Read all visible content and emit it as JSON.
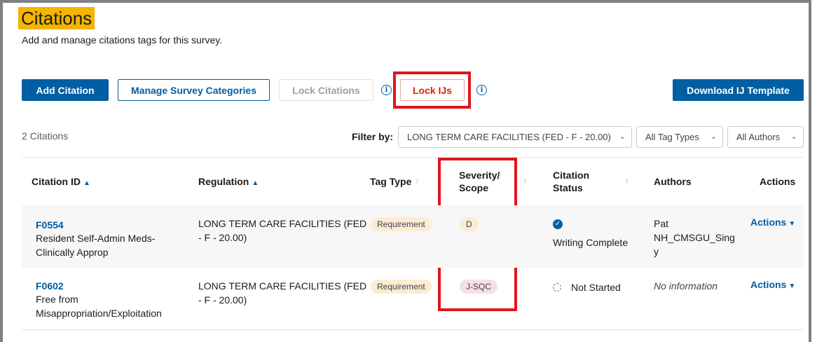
{
  "page": {
    "title": "Citations",
    "subtitle": "Add and manage citations tags for this survey."
  },
  "toolbar": {
    "add_citation": "Add Citation",
    "manage_categories": "Manage Survey Categories",
    "lock_citations": "Lock Citations",
    "lock_ijs": "Lock IJs",
    "download_ij_template": "Download IJ Template",
    "info_icon_glyph": "i"
  },
  "filters": {
    "count_label": "2 Citations",
    "filter_label": "Filter by:",
    "regulation_value": "LONG TERM CARE FACILITIES (FED - F - 20.00)",
    "tag_type_value": "All Tag Types",
    "authors_value": "All Authors"
  },
  "table": {
    "headers": {
      "citation_id": "Citation ID",
      "regulation": "Regulation",
      "tag_type": "Tag Type",
      "severity_line1": "Severity/",
      "severity_line2": "Scope",
      "status_line1": "Citation",
      "status_line2": "Status",
      "authors": "Authors",
      "actions": "Actions"
    },
    "rows": [
      {
        "id": "F0554",
        "desc_line1": "Resident Self-Admin Meds-",
        "desc_line2": "Clinically Approp",
        "regulation_line1": "LONG TERM CARE FACILITIES (FED",
        "regulation_line2": "- F - 20.00)",
        "tag_type": "Requirement",
        "severity": "D",
        "status": "Writing Complete",
        "author_line1": "Pat",
        "author_line2": "NH_CMSGU_Sing",
        "author_line3": "y",
        "actions": "Actions"
      },
      {
        "id": "F0602",
        "desc_line1": "Free from",
        "desc_line2": "Misappropriation/Exploitation",
        "regulation_line1": "LONG TERM CARE FACILITIES (FED",
        "regulation_line2": "- F - 20.00)",
        "tag_type": "Requirement",
        "severity": "J-SQC",
        "status": "Not Started",
        "author_none": "No information",
        "actions": "Actions"
      }
    ]
  },
  "colors": {
    "title_highlight": "#f4b400",
    "primary": "#005ea2",
    "annotation_red": "#e0161c",
    "tag_requirement": "#fdebd3",
    "severity_d": "#fdebd3",
    "severity_jsqc": "#f8dfe2"
  }
}
